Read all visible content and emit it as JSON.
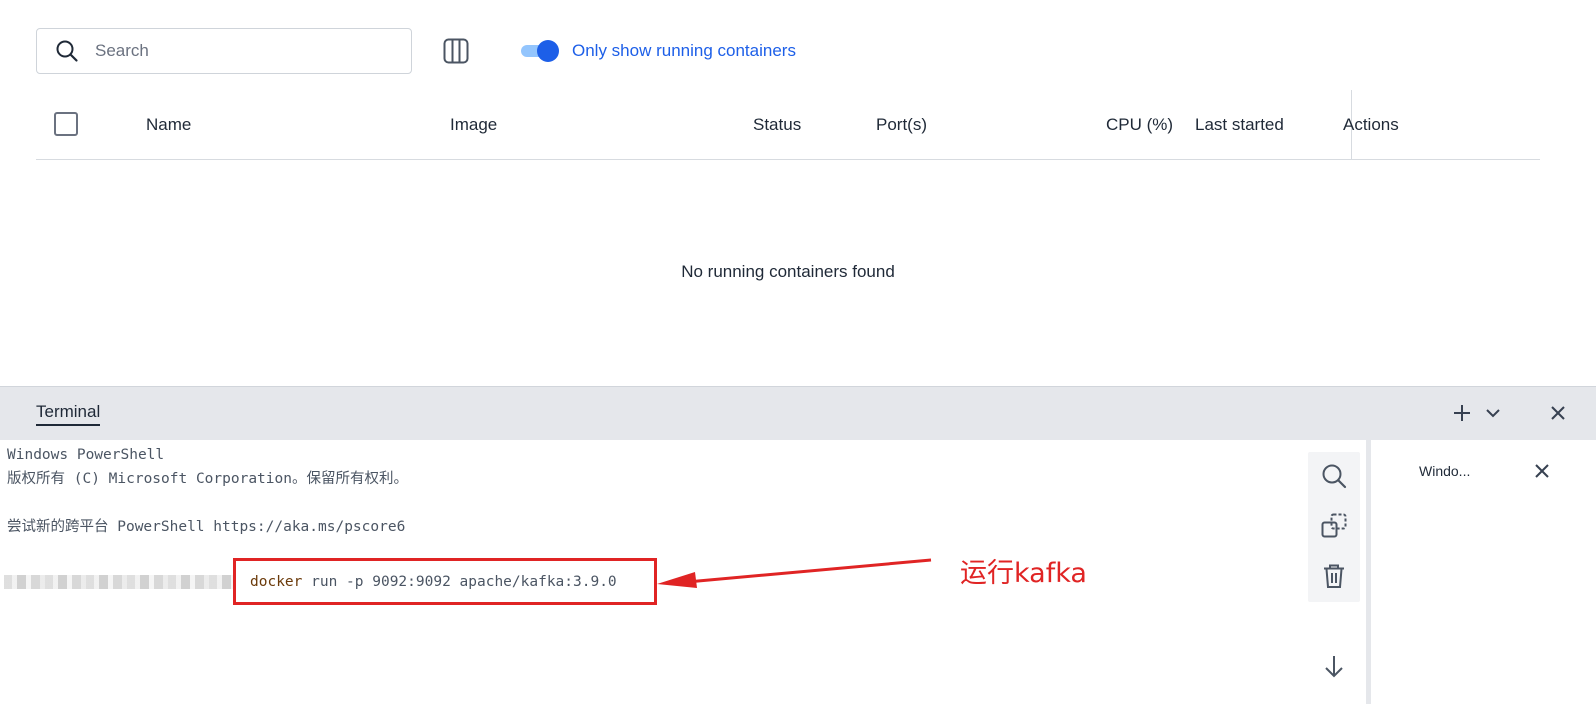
{
  "containers": {
    "search": {
      "placeholder": "Search",
      "value": ""
    },
    "toggle": {
      "label": "Only show running containers",
      "enabled": true,
      "color": "#1d5fe8"
    },
    "columns": {
      "name": "Name",
      "image": "Image",
      "status": "Status",
      "ports": "Port(s)",
      "cpu": "CPU (%)",
      "last_started": "Last started",
      "actions": "Actions"
    },
    "empty_message": "No running containers found"
  },
  "terminal": {
    "tab_label": "Terminal",
    "lines": [
      "Windows PowerShell",
      "版权所有 (C) Microsoft Corporation。保留所有权利。",
      "尝试新的跨平台 PowerShell https://aka.ms/pscore6"
    ],
    "command": {
      "program": "docker",
      "args": " run -p 9092:9092 apache/kafka:3.9.0"
    },
    "side_tab_label": "Windo..."
  },
  "annotation": {
    "label": "运行kafka",
    "color": "#e02424"
  },
  "icons": [
    "search-icon",
    "columns-icon",
    "plus-icon",
    "chevron-down-icon",
    "close-icon",
    "find-icon",
    "copy-icon",
    "trash-icon",
    "arrow-down-icon"
  ]
}
